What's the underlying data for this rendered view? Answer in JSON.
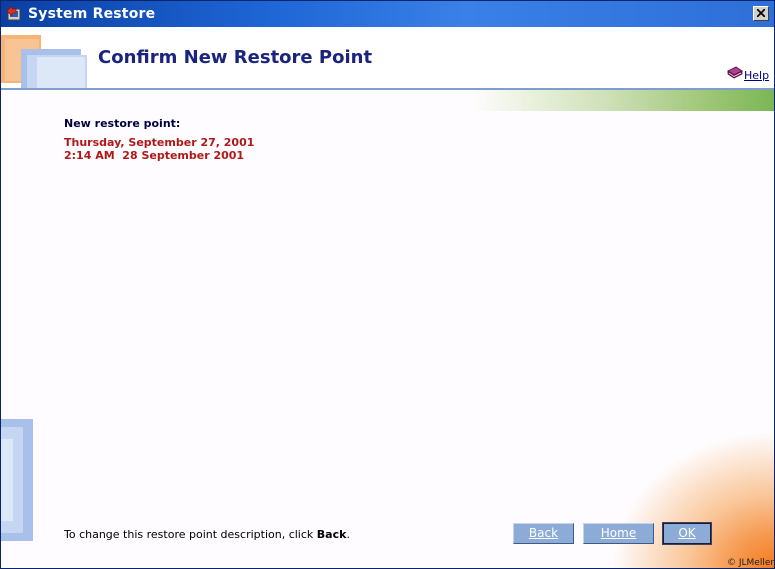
{
  "window": {
    "title": "System Restore",
    "icons": {
      "app": "system-restore-icon",
      "close": "close-icon"
    }
  },
  "header": {
    "title": "Confirm New Restore Point",
    "help_label": "Help",
    "help_icon": "help-book-icon"
  },
  "content": {
    "label": "New restore point:",
    "date_line": "Thursday, September 27, 2001",
    "description_line": "2:14 AM  28 September 2001"
  },
  "footer": {
    "instruction_prefix": "To change this restore point description, click ",
    "instruction_bold": "Back",
    "instruction_suffix": "."
  },
  "buttons": {
    "back": "Back",
    "home": "Home",
    "ok": "OK"
  },
  "copyright": "© JLMeller",
  "colors": {
    "title_text": "#1a237e",
    "restore_text": "#b01818",
    "button_bg": "#8cabd6",
    "titlebar": "#1f66d6"
  }
}
